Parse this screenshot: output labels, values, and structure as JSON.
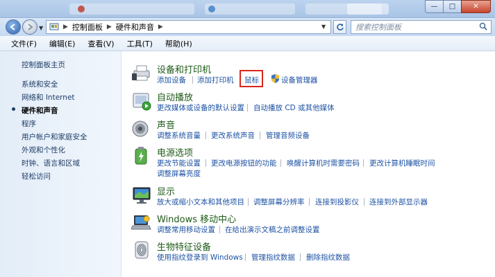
{
  "window": {
    "minimize_glyph": "—",
    "maximize_glyph": "□",
    "close_glyph": "✕"
  },
  "address": {
    "segments": [
      "控制面板",
      "硬件和声音"
    ],
    "separator": "▶",
    "search_placeholder": "搜索控制面板"
  },
  "menu": [
    "文件(F)",
    "编辑(E)",
    "查看(V)",
    "工具(T)",
    "帮助(H)"
  ],
  "sidebar": {
    "home": "控制面板主页",
    "items": [
      "系统和安全",
      "网络和 Internet",
      "硬件和声音",
      "程序",
      "用户帐户和家庭安全",
      "外观和个性化",
      "时钟、语言和区域",
      "轻松访问"
    ],
    "active_index": 2
  },
  "categories": [
    {
      "title": "设备和打印机",
      "icon": "printer-icon",
      "links": [
        "添加设备",
        "添加打印机",
        "鼠标",
        "设备管理器"
      ]
    },
    {
      "title": "自动播放",
      "icon": "autoplay-icon",
      "links": [
        "更改媒体或设备的默认设置",
        "自动播放 CD 或其他媒体"
      ]
    },
    {
      "title": "声音",
      "icon": "speaker-icon",
      "links": [
        "调整系统音量",
        "更改系统声音",
        "管理音频设备"
      ]
    },
    {
      "title": "电源选项",
      "icon": "power-icon",
      "links": [
        "更改节能设置",
        "更改电源按钮的功能",
        "唤醒计算机时需要密码",
        "更改计算机睡眠时间",
        "调整屏幕亮度"
      ]
    },
    {
      "title": "显示",
      "icon": "monitor-icon",
      "links": [
        "放大或缩小文本和其他项目",
        "调整屏幕分辨率",
        "连接到投影仪",
        "连接到外部显示器"
      ]
    },
    {
      "title": "Windows 移动中心",
      "icon": "mobility-center-icon",
      "links": [
        "调整常用移动设置",
        "在给出演示文稿之前调整设置"
      ]
    },
    {
      "title": "生物特征设备",
      "icon": "fingerprint-icon",
      "links": [
        "使用指纹登录到 Windows",
        "管理指纹数据",
        "删除指纹数据"
      ]
    }
  ],
  "colors": {
    "category_title": "#1d5a17",
    "link": "#1d52a3",
    "highlight_border": "#d9251c"
  }
}
